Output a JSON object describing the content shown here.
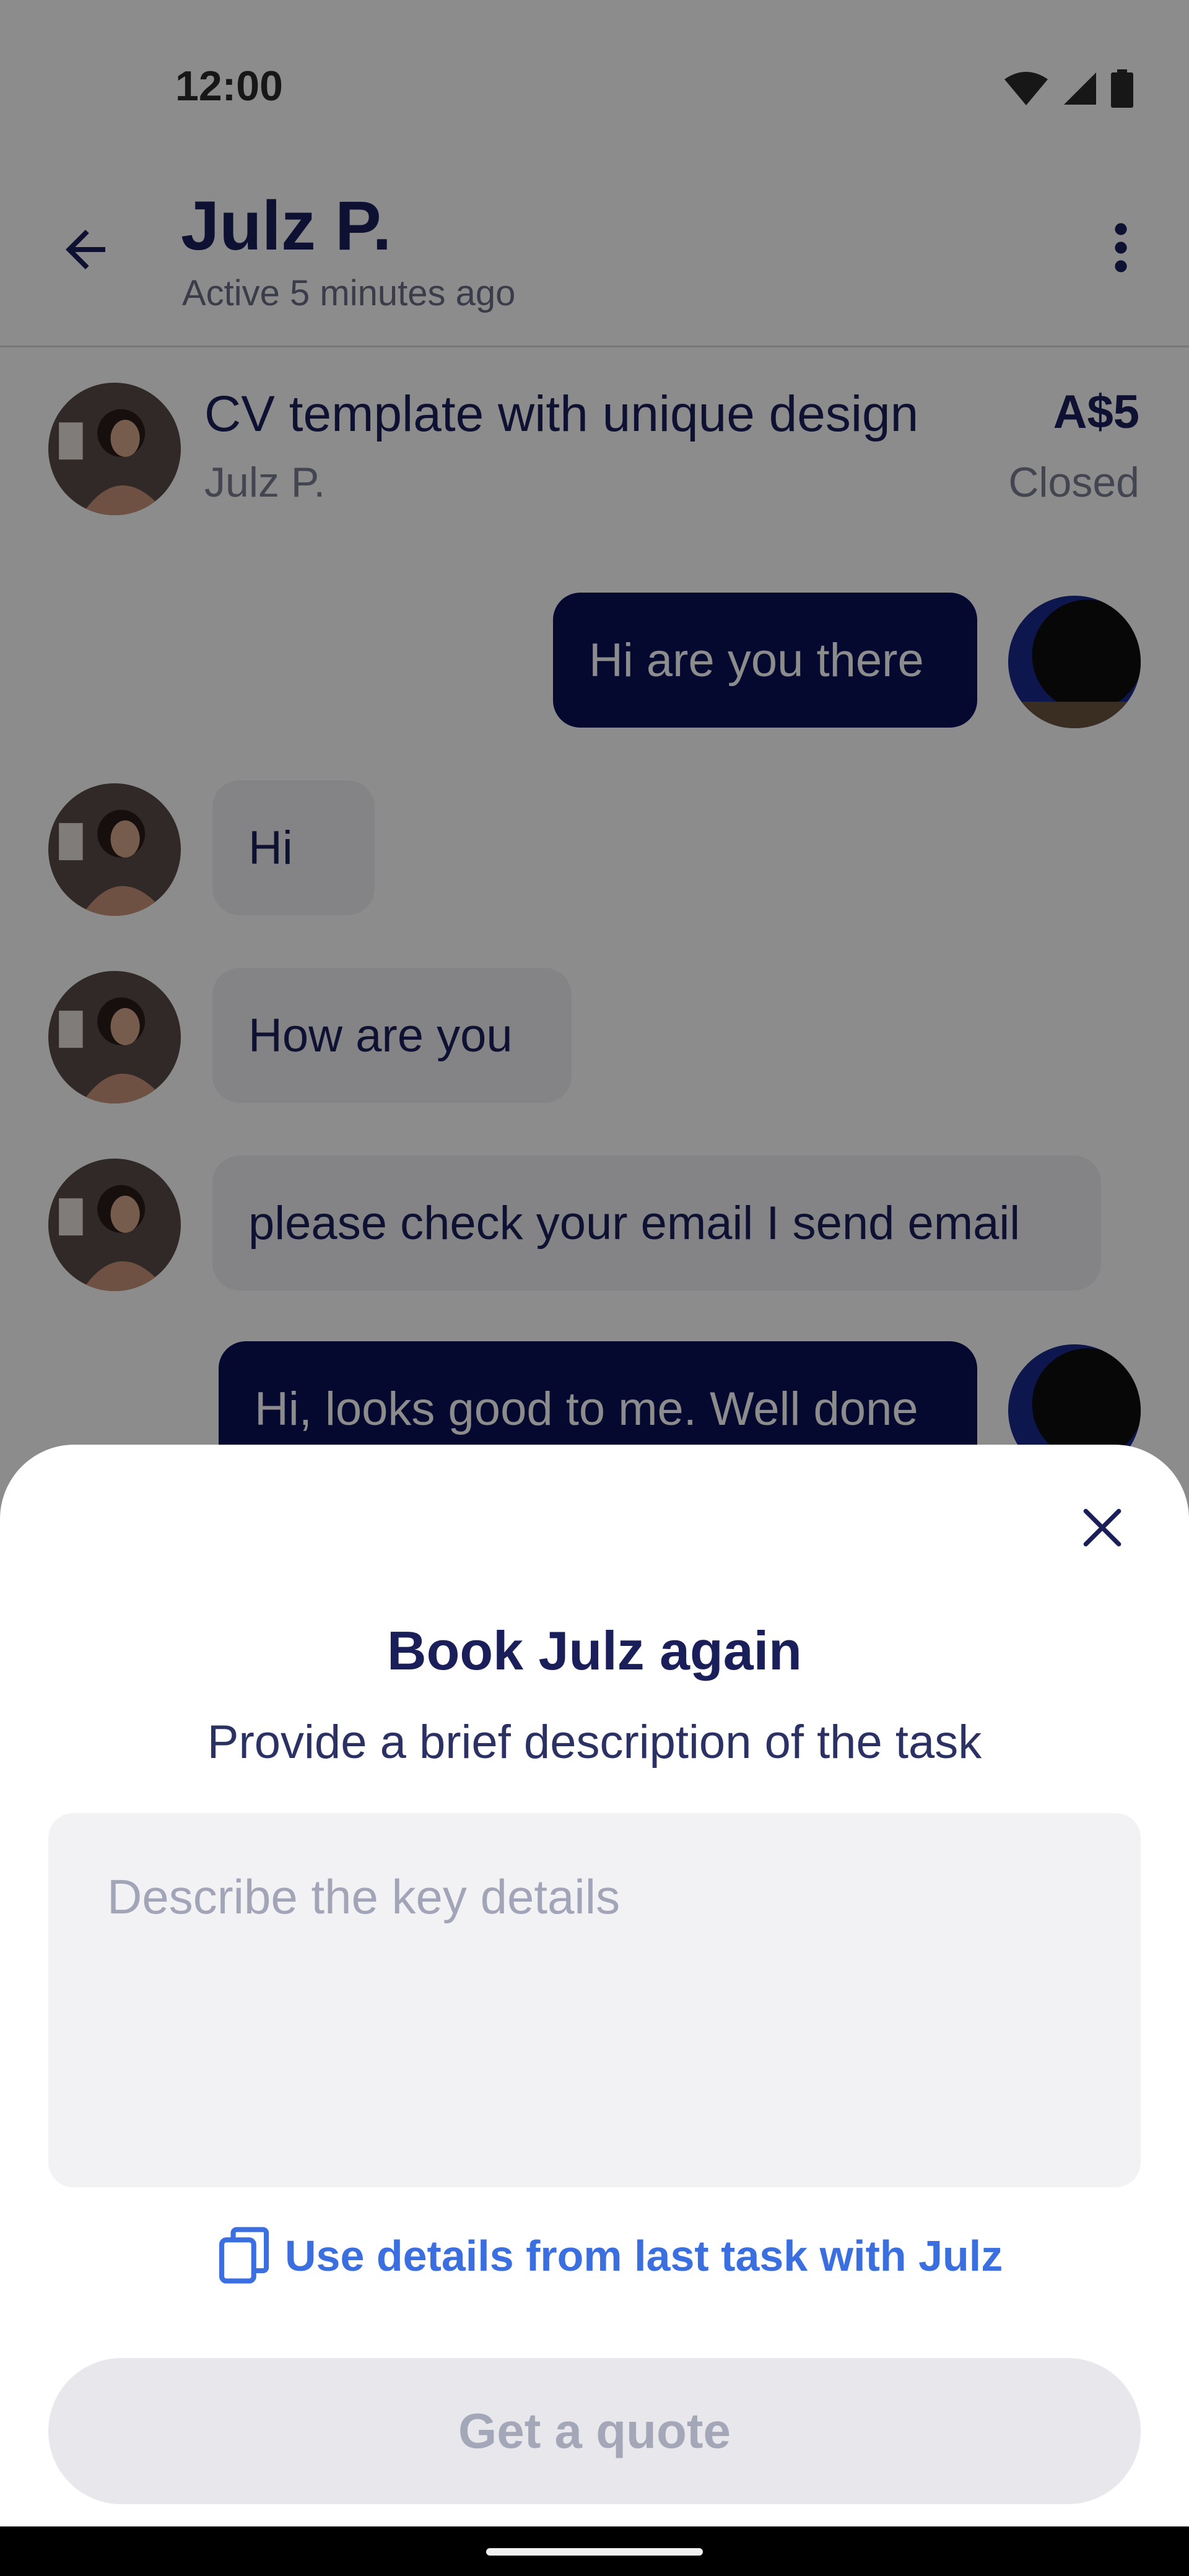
{
  "status_bar": {
    "time": "12:00"
  },
  "header": {
    "title": "Julz P.",
    "subtitle": "Active 5 minutes ago"
  },
  "task": {
    "title": "CV template with unique design",
    "user": "Julz P.",
    "price": "A$5",
    "status": "Closed"
  },
  "messages": [
    {
      "direction": "out",
      "text": "Hi are you there"
    },
    {
      "direction": "in",
      "text": "Hi"
    },
    {
      "direction": "in",
      "text": "How are you"
    },
    {
      "direction": "in",
      "text": "please check your email I send email"
    },
    {
      "direction": "out",
      "text": "Hi, looks good to me. Well done"
    }
  ],
  "sheet": {
    "title": "Book Julz again",
    "subtitle": "Provide a brief description of the task",
    "placeholder": "Describe the key details",
    "copy_link": "Use details from last task with Julz",
    "button": "Get a quote"
  },
  "colors": {
    "brand_dark": "#0a1158",
    "link_blue": "#3b6fe0",
    "overlay": "rgba(0,0,0,0.45)"
  },
  "icons": [
    "back-arrow-icon",
    "more-vert-icon",
    "wifi-icon",
    "signal-icon",
    "battery-icon",
    "close-icon",
    "copy-icon"
  ]
}
